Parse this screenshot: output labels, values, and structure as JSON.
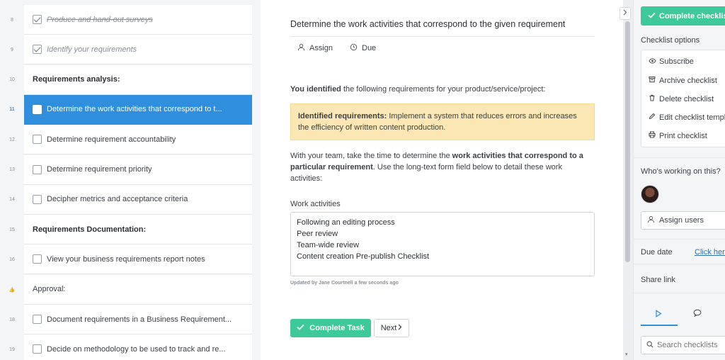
{
  "tasks": [
    {
      "num": "8",
      "label": "Produce and hand-out surveys",
      "checked": true,
      "strike": true
    },
    {
      "num": "9",
      "label": "Identify your requirements",
      "checked": true,
      "strike": false
    },
    {
      "num": "10",
      "label": "Requirements analysis:",
      "heading": true
    },
    {
      "num": "11",
      "label": "Determine the work activities that correspond to t...",
      "active": true
    },
    {
      "num": "12",
      "label": "Determine requirement accountability"
    },
    {
      "num": "13",
      "label": "Determine requirement priority"
    },
    {
      "num": "14",
      "label": "Decipher metrics and acceptance criteria"
    },
    {
      "num": "15",
      "label": "Requirements Documentation:",
      "heading": true
    },
    {
      "num": "16",
      "label": "View your business requirements report notes"
    },
    {
      "num": "👍",
      "label": "Approval:",
      "approval": true
    },
    {
      "num": "18",
      "label": "Document requirements in a Business Requirement..."
    },
    {
      "num": "19",
      "label": "Decide on methodology to be used to track and re..."
    }
  ],
  "main": {
    "title": "Determine the work activities that correspond to the given requirement",
    "assign_label": "Assign",
    "due_label": "Due",
    "intro_bold": "You identified",
    "intro_rest": " the following requirements for your product/service/project:",
    "highlight_bold": "Identified requirements:",
    "highlight_rest": " Implement a system that reduces errors and increases the efficiency of written content production.",
    "instr_a": "With your team, take the time to determine the ",
    "instr_bold": "work activities that correspond to a particular requirement",
    "instr_b": ". Use the long-text form field below to detail these work activities:",
    "field_label": "Work activities",
    "field_lines": [
      "Following an editing process",
      "Peer review",
      "Team-wide review",
      "Content creation Pre-publish Checklist"
    ],
    "updated_by": "Updated by Jane Courtnell a few seconds ago",
    "complete_task": "Complete Task",
    "next": "Next"
  },
  "sidebar": {
    "complete_checklist": "Complete checklist",
    "options_title": "Checklist options",
    "options": [
      {
        "icon": "eye-icon",
        "label": "Subscribe"
      },
      {
        "icon": "archive-icon",
        "label": "Archive checklist"
      },
      {
        "icon": "trash-icon",
        "label": "Delete checklist"
      },
      {
        "icon": "pencil-icon",
        "label": "Edit checklist template"
      },
      {
        "icon": "printer-icon",
        "label": "Print checklist"
      }
    ],
    "who": "Who's working on this?",
    "assign_users": "Assign users",
    "due_date": "Due date",
    "due_link": "Click here to set",
    "share_link": "Share link",
    "search_placeholder": "Search checklists"
  },
  "colors": {
    "accent_blue": "#2f8fde",
    "success_green": "#3ec99a",
    "highlight_yellow": "#fbe7b3"
  }
}
